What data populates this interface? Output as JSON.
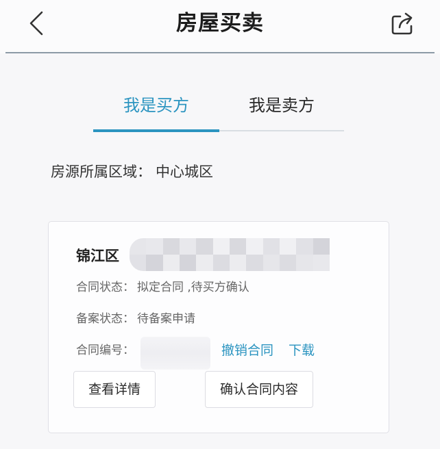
{
  "header": {
    "title": "房屋买卖",
    "back_icon": "chevron-left-icon",
    "share_icon": "share-icon"
  },
  "tabs": [
    {
      "label": "我是买方",
      "active": true
    },
    {
      "label": "我是卖方",
      "active": false
    }
  ],
  "region": {
    "label": "房源所属区域：",
    "value": "中心城区"
  },
  "contract_card": {
    "property_name": "锦江区",
    "fields": [
      {
        "label": "合同状态：",
        "value": "拟定合同 ,待买方确认"
      },
      {
        "label": "备案状态：",
        "value": "待备案申请"
      },
      {
        "label": "合同编号：",
        "value": ""
      }
    ],
    "links": {
      "revoke": "撤销合同",
      "download": "下载"
    },
    "buttons": {
      "details": "查看详情",
      "confirm": "确认合同内容"
    }
  },
  "colors": {
    "accent": "#2b94c0",
    "text_primary": "#222222",
    "text_secondary": "#666666",
    "divider": "#8c9aa6"
  }
}
